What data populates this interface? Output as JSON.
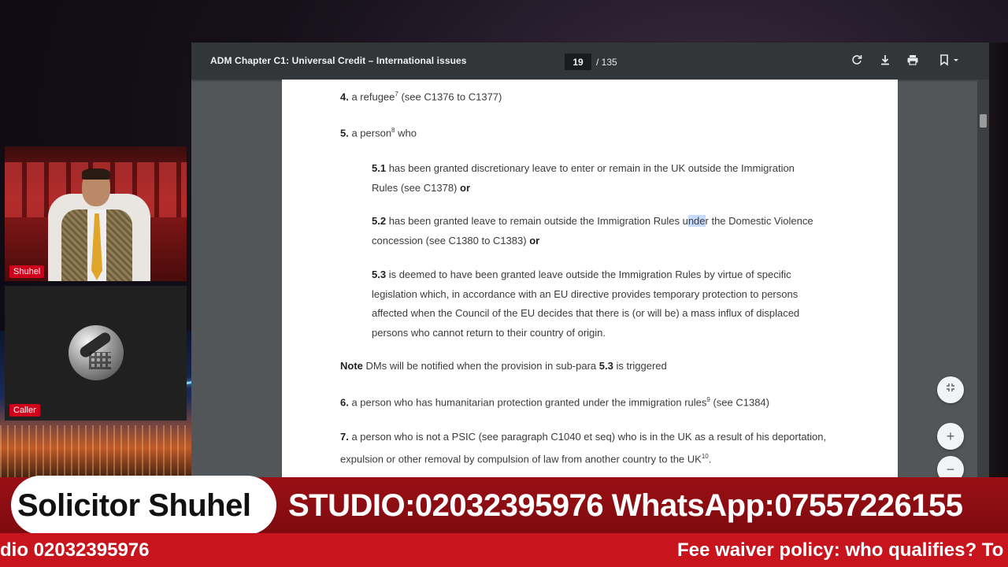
{
  "viewer": {
    "title": "ADM Chapter C1: Universal Credit – International issues",
    "page_current": "19",
    "page_total": "/ 135",
    "icons": [
      "rotate-icon",
      "download-icon",
      "print-icon",
      "bookmark-icon"
    ]
  },
  "document": {
    "l4_num": "4.",
    "l4_text": " a refugee",
    "l4_sup": "7",
    "l4_after": " (see C1376 to C1377)",
    "l5_num": "5.",
    "l5_text": " a person",
    "l5_sup": "8",
    "l5_after": " who",
    "l51a_num": "5.1",
    "l51a_text": " has been granted discretionary leave to enter or remain in the UK outside the Immigration",
    "l51b_text": "Rules (see C1378) ",
    "l51b_or": "or",
    "l52a_num": "5.2",
    "l52a_text1": " has been granted leave to remain outside the Immigration Rules u",
    "l52a_hl": "nde",
    "l52a_text2": "r the Domestic Violence",
    "l52b_text": "concession (see C1380 to C1383) ",
    "l52b_or": "or",
    "l53a_num": "5.3",
    "l53a_text": " is deemed to have been granted leave outside the Immigration Rules by virtue of specific",
    "l53b_text": "legislation which, in accordance with an EU directive provides temporary protection to persons",
    "l53c_text": "affected when the Council of the EU decides that there is (or will be) a mass influx of displaced",
    "l53d_text": "persons who cannot return to their country of origin.",
    "note_label": "Note",
    "note_text1": " DMs will be notified when the provision in sub-para ",
    "note_ref": "5.3",
    "note_text2": " is triggered",
    "l6_num": "6.",
    "l6_text": " a person who has humanitarian protection granted under the immigration rules",
    "l6_sup": "9",
    "l6_after": " (see C1384)",
    "l7a_num": "7.",
    "l7a_text": " a person who is not a PSIC (see paragraph C1040 et seq) who is in the UK as a result of his deportation,",
    "l7b_text": "expulsion or other removal by compulsion of law from another country to the UK",
    "l7b_sup": "10",
    "l7b_after": "."
  },
  "zoom_controls": {
    "fit_icon": "fit-page-icon",
    "zoom_in": "+",
    "zoom_out": "−"
  },
  "stream": {
    "host_name": "Shuhel",
    "caller_name": "Caller",
    "banner_name": "Solicitor Shuhel",
    "banner_contact": "STUDIO:02032395976 WhatsApp:07557226155",
    "ticker_left": "dio 02032395976",
    "ticker_right": "Fee waiver policy: who qualifies? To"
  },
  "colors": {
    "banner_red": "#9b0f14",
    "ticker_red": "#c8141c",
    "toolbar": "#323639",
    "viewer_bg": "#525659"
  }
}
